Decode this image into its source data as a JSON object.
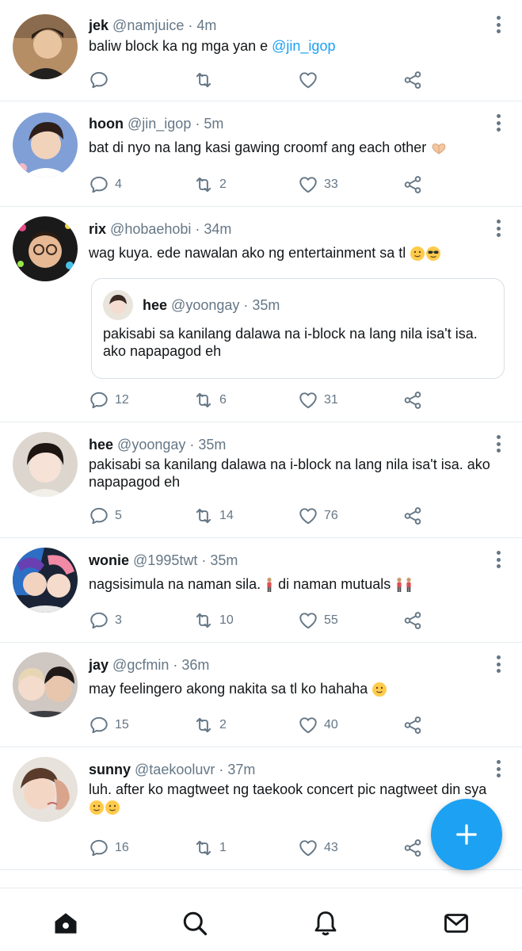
{
  "colors": {
    "accent": "#1da1f2",
    "text": "#14171a",
    "muted": "#657786",
    "divider": "#e6ecf0"
  },
  "tweets": [
    {
      "name": "jek",
      "handle": "@namjuice",
      "time": "4m",
      "text": "baliw block ka ng mga yan e ",
      "mention": "@jin_igop",
      "replies": "",
      "retweets": "",
      "likes": ""
    },
    {
      "name": "hoon",
      "handle": "@jin_igop",
      "time": "5m",
      "text": "bat di nyo na lang kasi gawing croomf ang each other",
      "emoji": "heart-hands",
      "replies": "4",
      "retweets": "2",
      "likes": "33"
    },
    {
      "name": "rix",
      "handle": "@hobaehobi",
      "time": "34m",
      "text": "wag kuya. ede nawalan ako ng entertainment sa tl",
      "emoji": "dizzy-face, sunglasses-face",
      "quote": {
        "name": "hee",
        "handle": "@yoongay",
        "time": "35m",
        "text": "pakisabi sa kanilang dalawa na i-block na lang nila isa't isa. ako napapagod eh"
      },
      "replies": "12",
      "retweets": "6",
      "likes": "31"
    },
    {
      "name": "hee",
      "handle": "@yoongay",
      "time": "35m",
      "text": "pakisabi sa kanilang dalawa na i-block na lang nila isa't isa. ako napapagod eh",
      "replies": "5",
      "retweets": "14",
      "likes": "76"
    },
    {
      "name": "wonie",
      "handle": "@1995twt",
      "time": "35m",
      "text_a": "nagsisimula na naman sila.",
      "text_b": "di naman mutuals",
      "emoji": "standing-person",
      "replies": "3",
      "retweets": "10",
      "likes": "55"
    },
    {
      "name": "jay",
      "handle": "@gcfmin",
      "time": "36m",
      "text": "may feelingero akong nakita sa tl ko hahaha",
      "emoji": "hand-over-mouth-face",
      "replies": "15",
      "retweets": "2",
      "likes": "40"
    },
    {
      "name": "sunny",
      "handle": "@taekooluvr",
      "time": "37m",
      "text": "luh. after ko magtweet ng taekook concert pic nagtweet din sya",
      "emoji": "thinking-face, dizzy-face",
      "replies": "16",
      "retweets": "1",
      "likes": "43"
    }
  ],
  "separator": " · ",
  "fab_icon": "plus-icon",
  "tabbar": [
    "home-icon",
    "search-icon",
    "bell-icon",
    "mail-icon"
  ]
}
